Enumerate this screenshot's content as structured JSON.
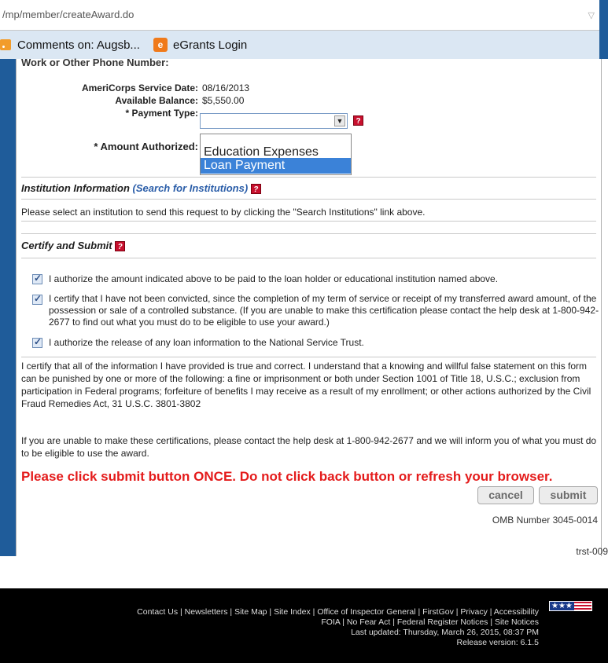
{
  "browser": {
    "url": "/mp/member/createAward.do",
    "bookmarks": [
      {
        "label": "Comments on: Augsb..."
      },
      {
        "label": "eGrants Login"
      }
    ]
  },
  "form": {
    "cutoff_label": "Work or Other Phone Number:",
    "service_date_label": "AmeriCorps Service Date:",
    "service_date_value": "08/16/2013",
    "balance_label": "Available Balance:",
    "balance_value": "$5,550.00",
    "payment_type_label": "* Payment Type:",
    "payment_type_value": "",
    "amount_label": "* Amount Authorized:",
    "payment_options": [
      "Education Expenses",
      "Loan Payment"
    ]
  },
  "institution": {
    "heading": "Institution Information",
    "search_link": "(Search for Institutions)",
    "instruction": "Please select an institution to send this request to by clicking the \"Search Institutions\" link above."
  },
  "certify": {
    "heading": "Certify and Submit",
    "checks": [
      {
        "checked": true,
        "text": "I authorize the amount indicated above to be paid to the loan holder or educational institution named above."
      },
      {
        "checked": true,
        "text": "I certify that I have not been convicted, since the completion of my term of service or receipt of my transferred award amount, of the possession or sale of a controlled substance. (If you are unable to make this certification please contact the help desk at 1-800-942-2677 to find out what you must do to be eligible to use your award.)"
      },
      {
        "checked": true,
        "text": "I authorize the release of any loan information to the National Service Trust."
      }
    ],
    "paragraph1": "I certify that all of the information I have provided is true and correct. I understand that a knowing and willful false statement on this form can be punished by one or more of the following: a fine or imprisonment or both under Section 1001 of Title 18, U.S.C.; exclusion from participation in Federal programs; forfeiture of benefits I may receive as a result of my enrollment; or other actions authorized by the Civil Fraud Remedies Act, 31 U.S.C. 3801-3802",
    "paragraph2": "If you are unable to make these certifications, please contact the help desk at 1-800-942-2677 and we will inform you of what you must do to be eligible to use the award.",
    "warning": "Please click submit button ONCE. Do not click back button or refresh your browser.",
    "cancel_label": "cancel",
    "submit_label": "submit",
    "omb": "OMB Number 3045-0014"
  },
  "page_id": "trst-009",
  "footer": {
    "line1": "Contact Us | Newsletters | Site Map | Site Index | Office of Inspector General | FirstGov | Privacy | Accessibility",
    "line2": "FOIA | No Fear Act | Federal Register Notices | Site Notices",
    "line3": "Last updated: Thursday, March 26, 2015, 08:37 PM",
    "line4": "Release version: 6.1.5",
    "flag_stars": "★★★"
  }
}
